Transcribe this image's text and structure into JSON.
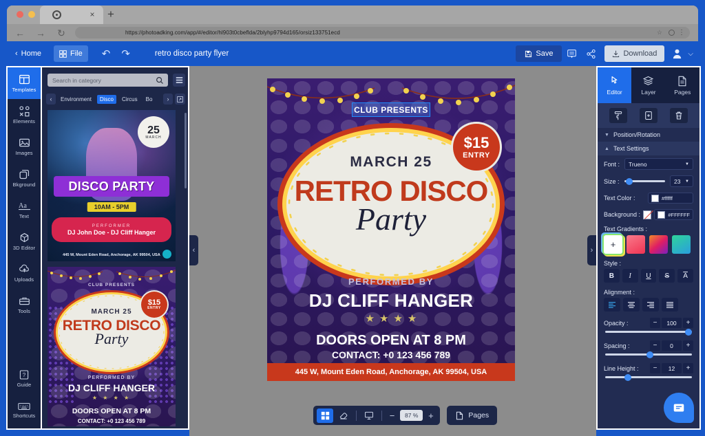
{
  "browser": {
    "url": "https://photoadking.com/app/#/editor/hl903t0cbeflda/2blyhp9794d165/orsiz133751ecd",
    "tab_close": "×",
    "tab_new": "+",
    "back": "←",
    "forward": "→",
    "reload": "↻",
    "star": "☆",
    "menu": "⋮"
  },
  "header": {
    "home": "Home",
    "file": "File",
    "undo": "↶",
    "redo": "↷",
    "title": "retro disco party flyer",
    "save": "Save",
    "download": "Download",
    "chevron": "⌵"
  },
  "rail": {
    "items": [
      {
        "label": "Templates",
        "icon": "templates-icon"
      },
      {
        "label": "Elements",
        "icon": "elements-icon"
      },
      {
        "label": "Images",
        "icon": "images-icon"
      },
      {
        "label": "Bkground",
        "icon": "background-icon"
      },
      {
        "label": "Text",
        "icon": "text-icon"
      },
      {
        "label": "3D Editor",
        "icon": "cube-icon"
      },
      {
        "label": "Uploads",
        "icon": "upload-icon"
      },
      {
        "label": "Tools",
        "icon": "toolbox-icon"
      }
    ],
    "bottom": [
      {
        "label": "Guide",
        "icon": "question-icon"
      },
      {
        "label": "Shortcuts",
        "icon": "keyboard-icon"
      }
    ],
    "active": "Templates"
  },
  "templates": {
    "search_placeholder": "Search in category",
    "search_value": "",
    "prev": "‹",
    "next": "›",
    "categories": [
      "Environment",
      "Disco",
      "Circus",
      "Bo"
    ],
    "active_category": "Disco",
    "cards": [
      {
        "title": "DISCO PARTY",
        "badge_day": "25",
        "badge_month": "MARCH",
        "time": "10AM - 5PM",
        "performer_label": "PERFORMER",
        "performers": "DJ John Doe  -  DJ Cliff Hanger",
        "address": "445 W, Mount Eden Road, Anchorage, AK 99504, USA"
      },
      {
        "club": "CLUB PRESENTS",
        "badge_price": "$15",
        "badge_entry": "ENTRY",
        "date": "MARCH 25",
        "title": "RETRO DISCO",
        "script": "Party",
        "performed_by": "PERFORMED BY",
        "dj": "DJ CLIFF HANGER",
        "stars": "★ ★ ★ ★",
        "doors": "DOORS OPEN AT 8 PM",
        "contact": "CONTACT: +0 123 456 789"
      }
    ]
  },
  "flyer": {
    "club": "CLUB PRESENTS",
    "badge_price": "$15",
    "badge_entry": "ENTRY",
    "date": "MARCH 25",
    "title": "RETRO DISCO",
    "script": "Party",
    "performed_by": "PERFORMED BY",
    "dj": "DJ CLIFF HANGER",
    "stars": "★★★★",
    "doors": "DOORS OPEN AT 8 PM",
    "contact": "CONTACT: +0 123 456 789",
    "address": "445 W, Mount Eden Road, Anchorage, AK 99504, USA"
  },
  "bottombar": {
    "grid": "grid-icon",
    "eraser": "eraser-icon",
    "present": "present-icon",
    "minus": "−",
    "zoom": "87 %",
    "plus": "+",
    "pages": "Pages"
  },
  "canvas": {
    "collapse_left": "‹",
    "collapse_right": "›"
  },
  "right_panel": {
    "tabs": [
      {
        "label": "Editor",
        "icon": "cursor-icon"
      },
      {
        "label": "Layer",
        "icon": "layers-icon"
      },
      {
        "label": "Pages",
        "icon": "page-icon"
      }
    ],
    "active_tab": "Editor",
    "actions": [
      {
        "name": "format-painter",
        "icon": "brush-icon"
      },
      {
        "name": "duplicate",
        "icon": "copy-icon"
      },
      {
        "name": "delete",
        "icon": "trash-icon"
      }
    ],
    "sections": {
      "position_rotation": "Position/Rotation",
      "text_settings": "Text Settings"
    },
    "font_label": "Font :",
    "font_value": "Trueno",
    "size_label": "Size :",
    "size_value": "23",
    "text_color_label": "Text Color :",
    "text_color_value": "#ffffff",
    "background_label": "Background :",
    "background_value": "#FFFFFF",
    "gradients_label": "Text Gradients :",
    "gradients": [
      "add",
      "#f4455e",
      "#e8513c",
      "#2fcfa8"
    ],
    "style_label": "Style :",
    "styles": [
      "B",
      "I",
      "U",
      "S",
      "A"
    ],
    "alignment_label": "Alignment :",
    "alignments": [
      "left",
      "center",
      "right",
      "justify"
    ],
    "active_alignment": "left",
    "opacity_label": "Opacity :",
    "opacity_value": "100",
    "spacing_label": "Spacing :",
    "spacing_value": "0",
    "line_height_label": "Line Height :",
    "line_height_value": "12",
    "minus": "−",
    "plus": "+",
    "chat": "chat-icon"
  }
}
